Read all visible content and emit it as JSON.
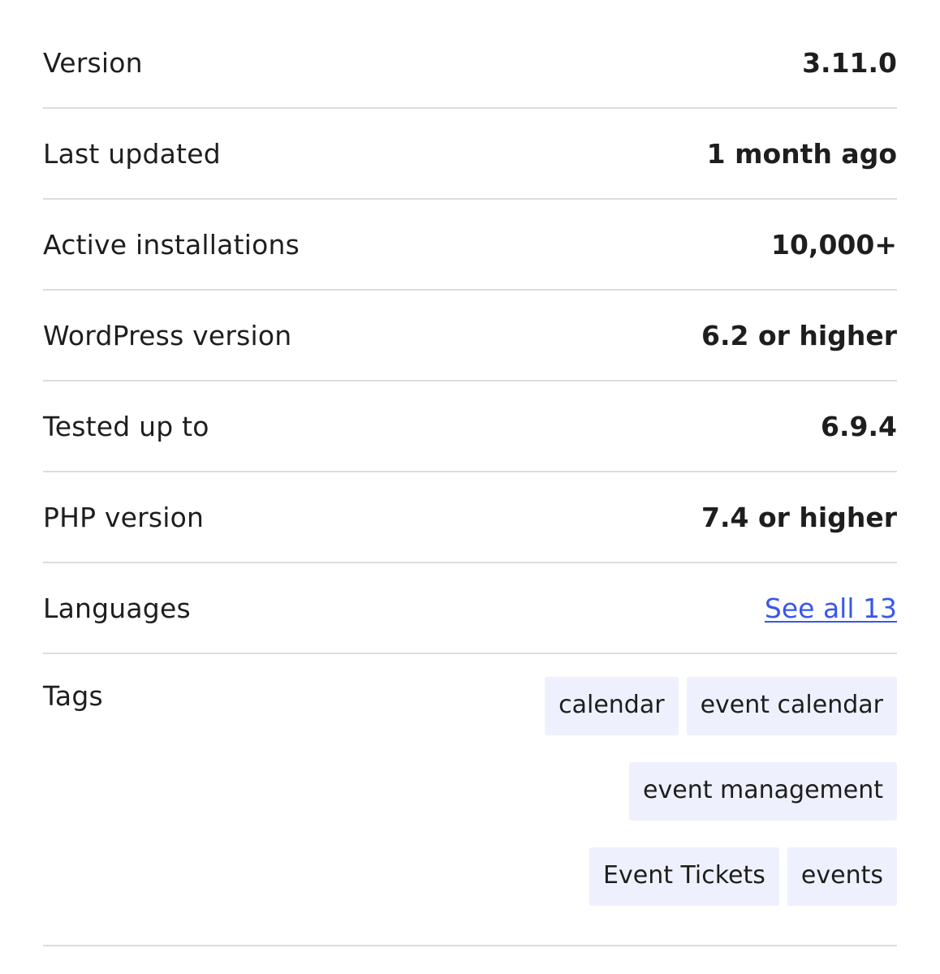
{
  "meta": {
    "version": {
      "label": "Version",
      "value": "3.11.0"
    },
    "last_updated": {
      "label": "Last updated",
      "value": "1 month ago"
    },
    "active_installations": {
      "label": "Active installations",
      "value": "10,000+"
    },
    "wordpress_version": {
      "label": "WordPress version",
      "value": "6.2 or higher"
    },
    "tested_up_to": {
      "label": "Tested up to",
      "value": "6.9.4"
    },
    "php_version": {
      "label": "PHP version",
      "value": "7.4 or higher"
    },
    "languages": {
      "label": "Languages",
      "link_text": "See all 13"
    },
    "tags": {
      "label": "Tags",
      "items": [
        "calendar",
        "event calendar",
        "event management",
        "Event Tickets",
        "events"
      ]
    }
  },
  "colors": {
    "link": "#3858e9",
    "tag_background": "#eef1fd",
    "divider": "#dcdcde",
    "text": "#1e1e1e"
  }
}
